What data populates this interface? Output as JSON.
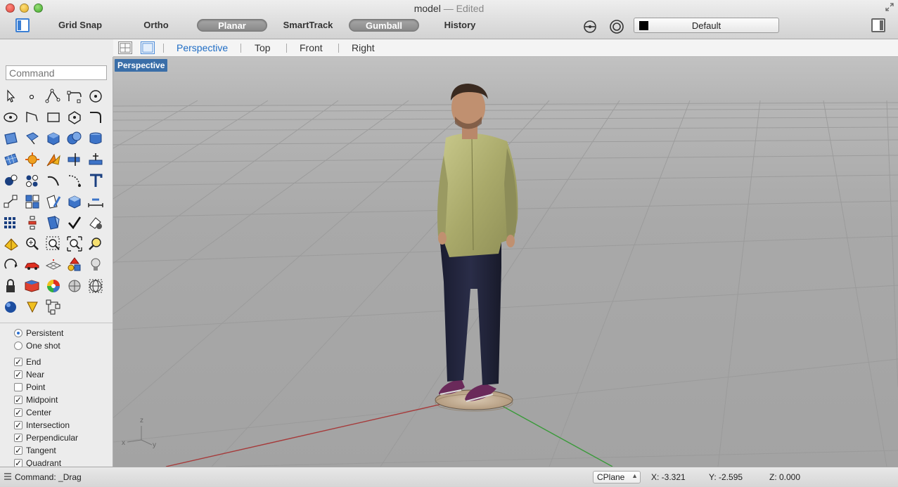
{
  "window": {
    "title": "model",
    "title_suffix": "— Edited"
  },
  "toolbar": {
    "items": [
      {
        "label": "Grid Snap",
        "active": false
      },
      {
        "label": "Ortho",
        "active": false
      },
      {
        "label": "Planar",
        "active": true
      },
      {
        "label": "SmartTrack",
        "active": false
      },
      {
        "label": "Gumball",
        "active": true
      },
      {
        "label": "History",
        "active": false
      }
    ],
    "layer": {
      "name": "Default",
      "swatch_color": "#000000"
    }
  },
  "view_tabs": {
    "tabs": [
      {
        "label": "Perspective",
        "active": true
      },
      {
        "label": "Top",
        "active": false
      },
      {
        "label": "Front",
        "active": false
      },
      {
        "label": "Right",
        "active": false
      }
    ],
    "accent_color": "#1f6dc5"
  },
  "sidebar": {
    "command_placeholder": "Command",
    "snap_modes": [
      {
        "label": "Persistent",
        "selected": true
      },
      {
        "label": "One shot",
        "selected": false
      }
    ],
    "osnaps": [
      {
        "label": "End",
        "checked": true
      },
      {
        "label": "Near",
        "checked": true
      },
      {
        "label": "Point",
        "checked": false
      },
      {
        "label": "Midpoint",
        "checked": true
      },
      {
        "label": "Center",
        "checked": true
      },
      {
        "label": "Intersection",
        "checked": true
      },
      {
        "label": "Perpendicular",
        "checked": true
      },
      {
        "label": "Tangent",
        "checked": true
      },
      {
        "label": "Quadrant",
        "checked": true
      }
    ]
  },
  "viewport": {
    "label": "Perspective",
    "axis_labels": {
      "z": "z",
      "x": "x",
      "y": "y"
    }
  },
  "status": {
    "command": "Command: _Drag",
    "cplane": "CPlane",
    "x": "X: -3.321",
    "y": "Y: -2.595",
    "z": "Z: 0.000"
  }
}
